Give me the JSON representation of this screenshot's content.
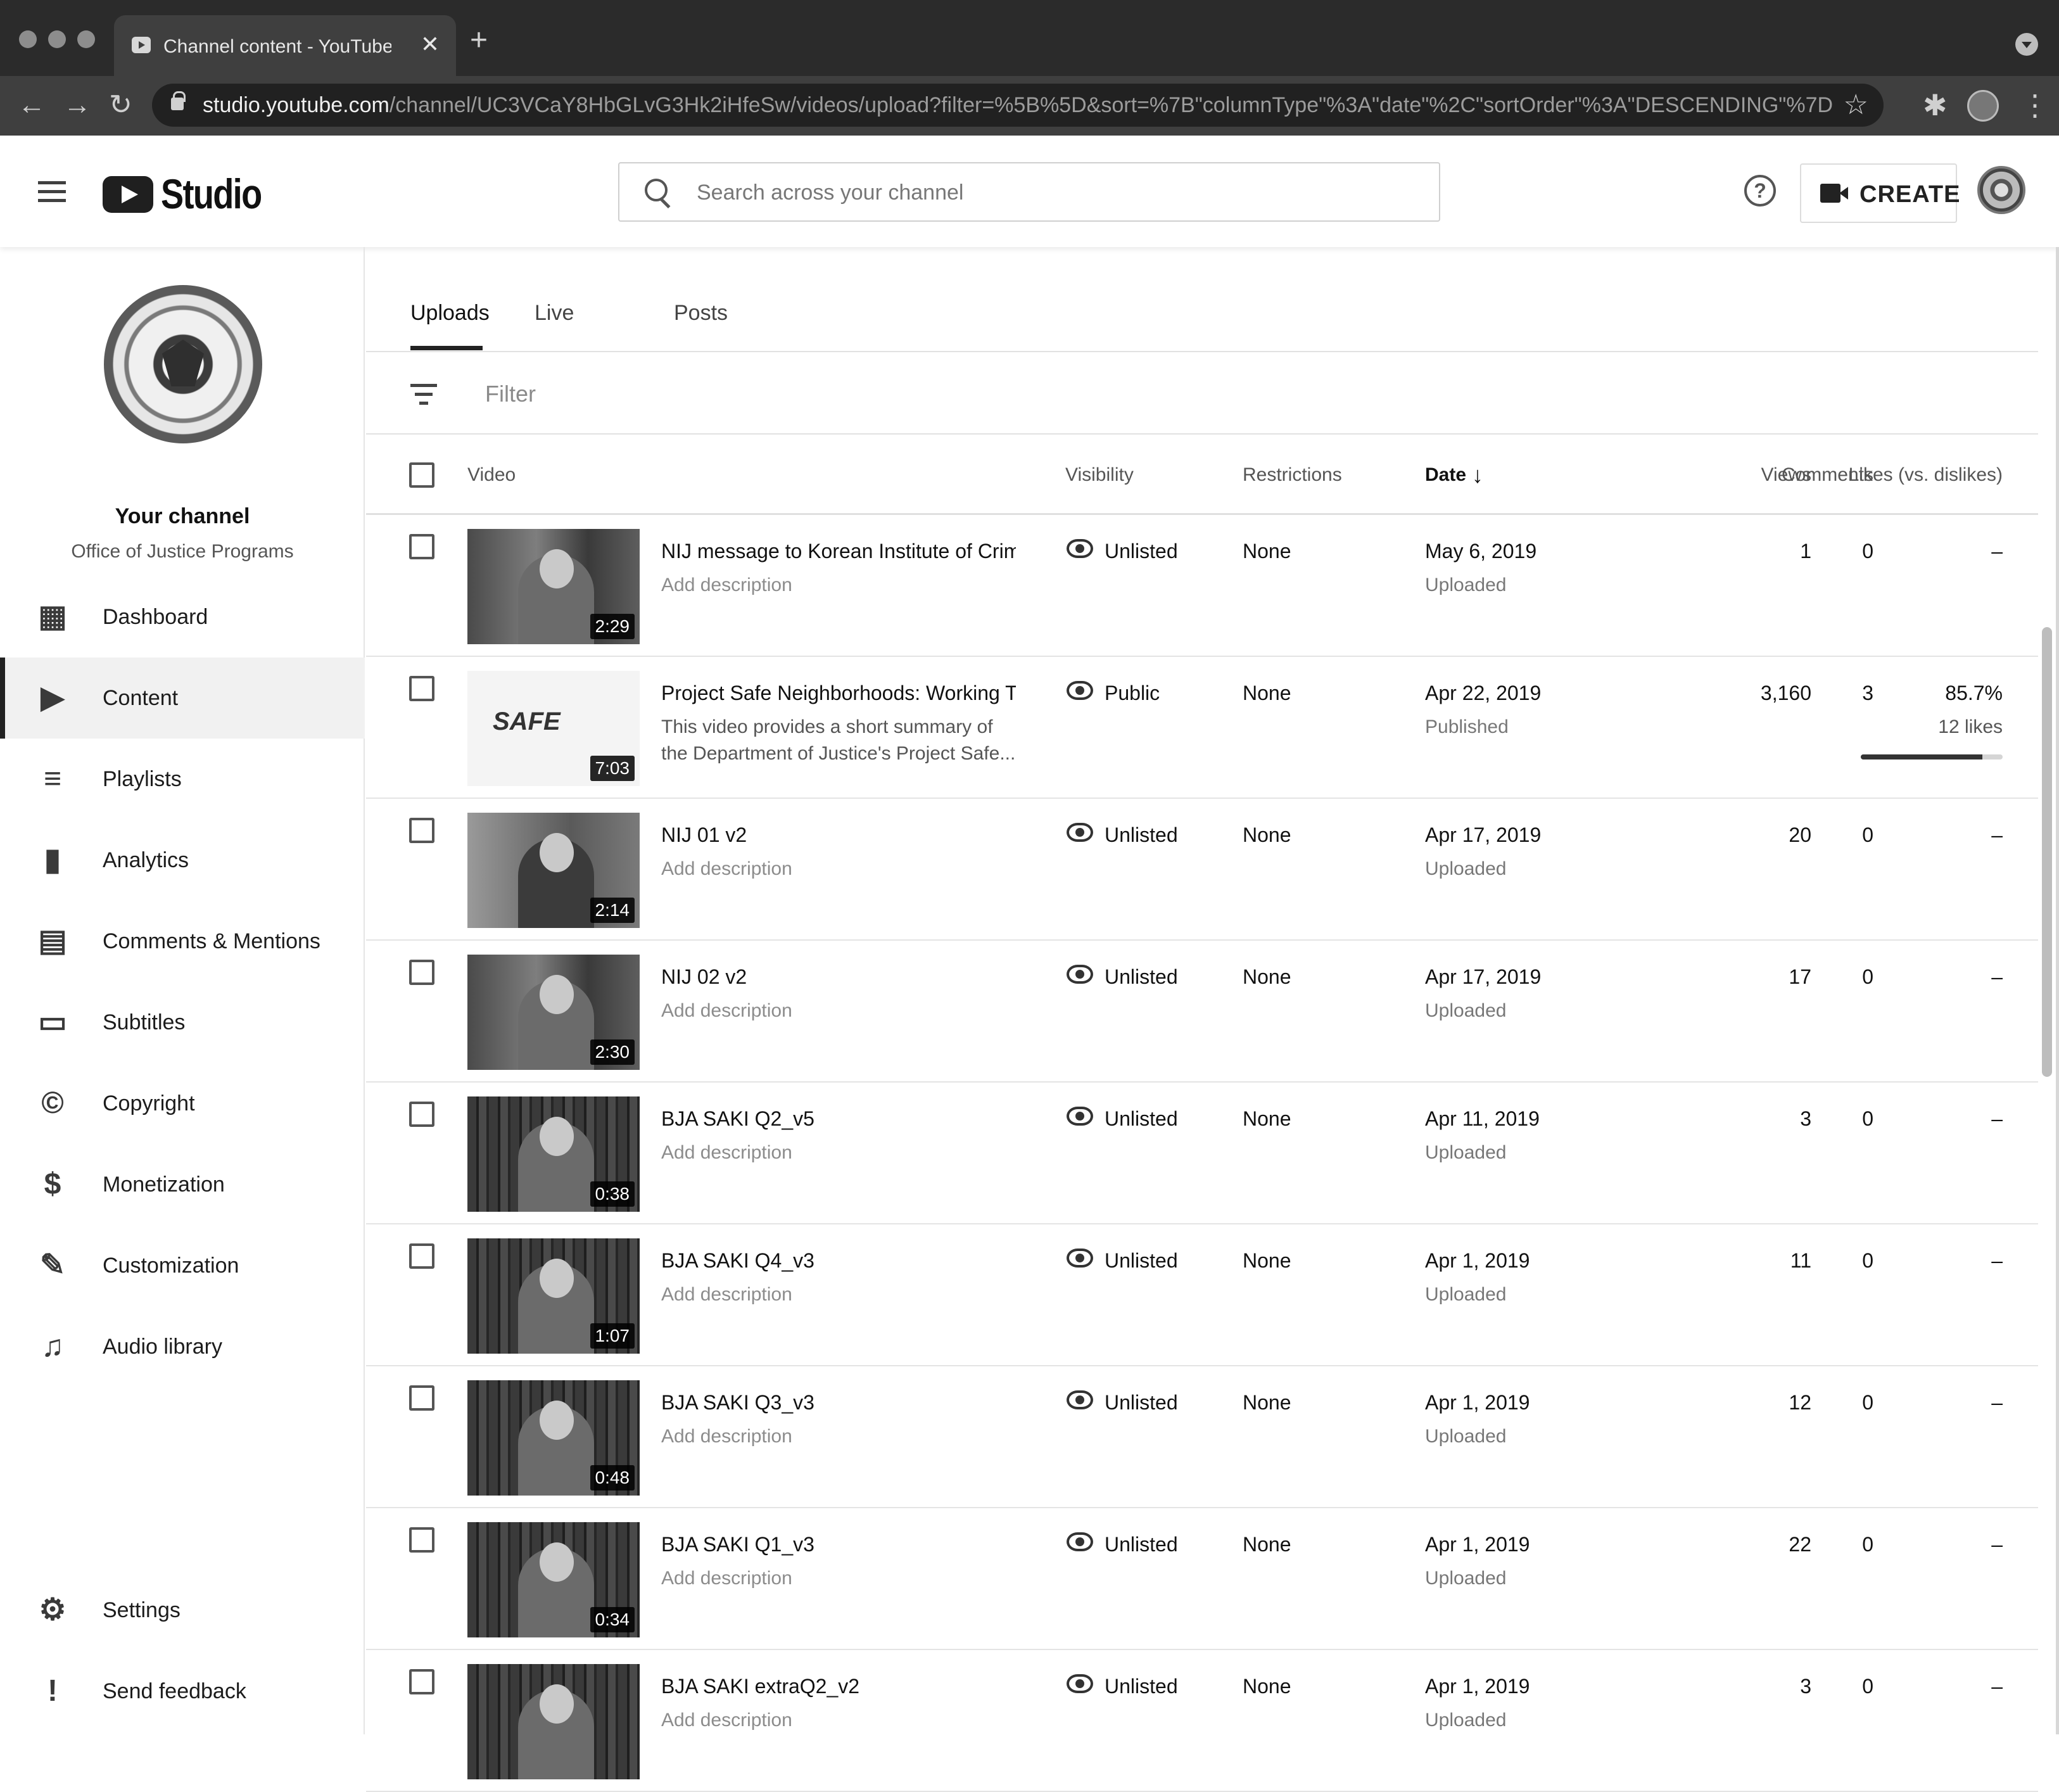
{
  "browser": {
    "tab_title": "Channel content - YouTube Stu",
    "tab_close": "✕",
    "new_tab": "+",
    "url_host": "studio.youtube.com",
    "url_path": "/channel/UC3VCaY8HbGLvG3Hk2iHfeSw/videos/upload?filter=%5B%5D&sort=%7B\"columnType\"%3A\"date\"%2C\"sortOrder\"%3A\"DESCENDING\"%7D",
    "back": "←",
    "forward": "→",
    "reload": "↻",
    "star": "☆",
    "extensions": "✱",
    "menu": "⋮"
  },
  "header": {
    "logo_text": "Studio",
    "search_placeholder": "Search across your channel",
    "help": "?",
    "create_label": "CREATE"
  },
  "sidebar": {
    "channel_name": "Your channel",
    "channel_sub": "Office of Justice Programs",
    "items": [
      {
        "label": "Dashboard",
        "icon": "dashboard-icon",
        "glyph": "▦",
        "active": false
      },
      {
        "label": "Content",
        "icon": "content-icon",
        "glyph": "▶",
        "active": true
      },
      {
        "label": "Playlists",
        "icon": "playlists-icon",
        "glyph": "≡",
        "active": false
      },
      {
        "label": "Analytics",
        "icon": "analytics-icon",
        "glyph": "▮",
        "active": false
      },
      {
        "label": "Comments & Mentions",
        "icon": "comments-icon",
        "glyph": "▤",
        "active": false
      },
      {
        "label": "Subtitles",
        "icon": "subtitles-icon",
        "glyph": "▭",
        "active": false
      },
      {
        "label": "Copyright",
        "icon": "copyright-icon",
        "glyph": "©",
        "active": false
      },
      {
        "label": "Monetization",
        "icon": "dollar-icon",
        "glyph": "$",
        "active": false
      },
      {
        "label": "Customization",
        "icon": "magic-wand-icon",
        "glyph": "✎",
        "active": false
      },
      {
        "label": "Audio library",
        "icon": "audio-library-icon",
        "glyph": "♫",
        "active": false
      }
    ],
    "bottom_items": [
      {
        "label": "Settings",
        "icon": "gear-icon",
        "glyph": "⚙"
      },
      {
        "label": "Send feedback",
        "icon": "feedback-icon",
        "glyph": "!"
      }
    ]
  },
  "tabs": [
    "Uploads",
    "Live",
    "Posts"
  ],
  "filter_label": "Filter",
  "columns": {
    "video": "Video",
    "visibility": "Visibility",
    "restrictions": "Restrictions",
    "date": "Date",
    "date_arrow": "↓",
    "views": "Views",
    "comments": "Comments",
    "likes": "Likes (vs. dislikes)"
  },
  "videos": [
    {
      "title": "NIJ message to Korean Institute of Crimi...",
      "description": "Add description",
      "has_description": false,
      "duration": "2:29",
      "visibility": "Unlisted",
      "restrictions": "None",
      "date": "May 6, 2019",
      "date_status": "Uploaded",
      "views": "1",
      "comments": "0",
      "likes": "–",
      "thumb": "speaker"
    },
    {
      "title": "Project Safe Neighborhoods: Working To...",
      "description": "This video provides a short summary of the Department of Justice's Project Safe...",
      "has_description": true,
      "duration": "7:03",
      "visibility": "Public",
      "restrictions": "None",
      "date": "Apr 22, 2019",
      "date_status": "Published",
      "views": "3,160",
      "comments": "3",
      "likes": "85.7%",
      "likes_sub": "12 likes",
      "likes_ratio": 0.857,
      "thumb": "logo",
      "thumb_logo_text": "SAFE"
    },
    {
      "title": "NIJ 01 v2",
      "description": "Add description",
      "has_description": false,
      "duration": "2:14",
      "visibility": "Unlisted",
      "restrictions": "None",
      "date": "Apr 17, 2019",
      "date_status": "Uploaded",
      "views": "20",
      "comments": "0",
      "likes": "–",
      "thumb": "speaker-light"
    },
    {
      "title": "NIJ 02 v2",
      "description": "Add description",
      "has_description": false,
      "duration": "2:30",
      "visibility": "Unlisted",
      "restrictions": "None",
      "date": "Apr 17, 2019",
      "date_status": "Uploaded",
      "views": "17",
      "comments": "0",
      "likes": "–",
      "thumb": "speaker"
    },
    {
      "title": "BJA SAKI Q2_v5",
      "description": "Add description",
      "has_description": false,
      "duration": "0:38",
      "visibility": "Unlisted",
      "restrictions": "None",
      "date": "Apr 11, 2019",
      "date_status": "Uploaded",
      "views": "3",
      "comments": "0",
      "likes": "–",
      "thumb": "library"
    },
    {
      "title": "BJA SAKI Q4_v3",
      "description": "Add description",
      "has_description": false,
      "duration": "1:07",
      "visibility": "Unlisted",
      "restrictions": "None",
      "date": "Apr 1, 2019",
      "date_status": "Uploaded",
      "views": "11",
      "comments": "0",
      "likes": "–",
      "thumb": "library"
    },
    {
      "title": "BJA SAKI Q3_v3",
      "description": "Add description",
      "has_description": false,
      "duration": "0:48",
      "visibility": "Unlisted",
      "restrictions": "None",
      "date": "Apr 1, 2019",
      "date_status": "Uploaded",
      "views": "12",
      "comments": "0",
      "likes": "–",
      "thumb": "library"
    },
    {
      "title": "BJA SAKI Q1_v3",
      "description": "Add description",
      "has_description": false,
      "duration": "0:34",
      "visibility": "Unlisted",
      "restrictions": "None",
      "date": "Apr 1, 2019",
      "date_status": "Uploaded",
      "views": "22",
      "comments": "0",
      "likes": "–",
      "thumb": "library"
    },
    {
      "title": "BJA SAKI extraQ2_v2",
      "description": "Add description",
      "has_description": false,
      "duration": "",
      "visibility": "Unlisted",
      "restrictions": "None",
      "date": "Apr 1, 2019",
      "date_status": "Uploaded",
      "views": "3",
      "comments": "0",
      "likes": "–",
      "thumb": "library"
    }
  ],
  "colors": {
    "chrome_bg": "#2b2b2b",
    "text": "#111111",
    "muted": "#8c8c8c",
    "active_nav": "#f1f1f1"
  }
}
